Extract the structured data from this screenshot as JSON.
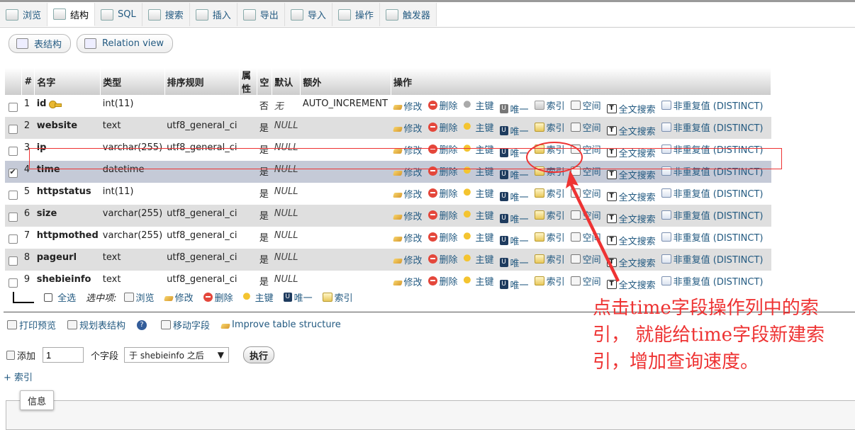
{
  "tabs": [
    {
      "label": "浏览",
      "icon": "browse-icon",
      "active": false
    },
    {
      "label": "结构",
      "icon": "structure-icon",
      "active": true
    },
    {
      "label": "SQL",
      "icon": "sql-icon",
      "active": false
    },
    {
      "label": "搜索",
      "icon": "search-icon",
      "active": false
    },
    {
      "label": "插入",
      "icon": "insert-icon",
      "active": false
    },
    {
      "label": "导出",
      "icon": "export-icon",
      "active": false
    },
    {
      "label": "导入",
      "icon": "import-icon",
      "active": false
    },
    {
      "label": "操作",
      "icon": "operations-icon",
      "active": false
    },
    {
      "label": "触发器",
      "icon": "triggers-icon",
      "active": false
    }
  ],
  "subtabs": [
    {
      "label": "表结构",
      "icon": "table-structure-icon"
    },
    {
      "label": "Relation view",
      "icon": "relation-view-icon"
    }
  ],
  "table": {
    "headers": [
      "#",
      "名字",
      "类型",
      "排序规则",
      "属性",
      "空",
      "默认",
      "额外",
      "操作"
    ],
    "rows": [
      {
        "num": "1",
        "name": "id",
        "primary": true,
        "type": "int(11)",
        "collation": "",
        "attributes": "",
        "null": "否",
        "default": "无",
        "extra": "AUTO_INCREMENT",
        "checked": false
      },
      {
        "num": "2",
        "name": "website",
        "primary": false,
        "type": "text",
        "collation": "utf8_general_ci",
        "attributes": "",
        "null": "是",
        "default": "NULL",
        "extra": "",
        "checked": false
      },
      {
        "num": "3",
        "name": "ip",
        "primary": false,
        "type": "varchar(255)",
        "collation": "utf8_general_ci",
        "attributes": "",
        "null": "是",
        "default": "NULL",
        "extra": "",
        "checked": false
      },
      {
        "num": "4",
        "name": "time",
        "primary": false,
        "type": "datetime",
        "collation": "",
        "attributes": "",
        "null": "是",
        "default": "NULL",
        "extra": "",
        "checked": true
      },
      {
        "num": "5",
        "name": "httpstatus",
        "primary": false,
        "type": "int(11)",
        "collation": "",
        "attributes": "",
        "null": "是",
        "default": "NULL",
        "extra": "",
        "checked": false
      },
      {
        "num": "6",
        "name": "size",
        "primary": false,
        "type": "varchar(255)",
        "collation": "utf8_general_ci",
        "attributes": "",
        "null": "是",
        "default": "NULL",
        "extra": "",
        "checked": false
      },
      {
        "num": "7",
        "name": "httpmothed",
        "primary": false,
        "type": "varchar(255)",
        "collation": "utf8_general_ci",
        "attributes": "",
        "null": "是",
        "default": "NULL",
        "extra": "",
        "checked": false
      },
      {
        "num": "8",
        "name": "pageurl",
        "primary": false,
        "type": "text",
        "collation": "utf8_general_ci",
        "attributes": "",
        "null": "是",
        "default": "NULL",
        "extra": "",
        "checked": false
      },
      {
        "num": "9",
        "name": "shebieinfo",
        "primary": false,
        "type": "text",
        "collation": "utf8_general_ci",
        "attributes": "",
        "null": "是",
        "default": "NULL",
        "extra": "",
        "checked": false
      }
    ],
    "actions": {
      "edit": "修改",
      "drop": "删除",
      "primary": "主键",
      "unique": "唯一",
      "index": "索引",
      "spatial": "空间",
      "fulltext": "全文搜索",
      "distinct": "非重复值 (DISTINCT)"
    }
  },
  "bulk": {
    "check_all": "全选",
    "with_selected": "选中项:",
    "browse": "浏览",
    "edit": "修改",
    "drop": "删除",
    "primary": "主键",
    "unique": "唯一",
    "index": "索引"
  },
  "tools": {
    "print": "打印预览",
    "propose": "规划表结构",
    "move": "移动字段",
    "improve": "Improve table structure"
  },
  "add": {
    "label": "添加",
    "count": "1",
    "suffix": "个字段",
    "position": "于 shebieinfo 之后",
    "go": "执行"
  },
  "index_link": "+ 索引",
  "info_tab": "信息",
  "annotation": "点击time字段操作列中的索引， 就能给time字段新建索引，增加查询速度。",
  "colors": {
    "accent": "#235a81",
    "annotation": "#e33333",
    "selected_row": "#c5cad7"
  }
}
